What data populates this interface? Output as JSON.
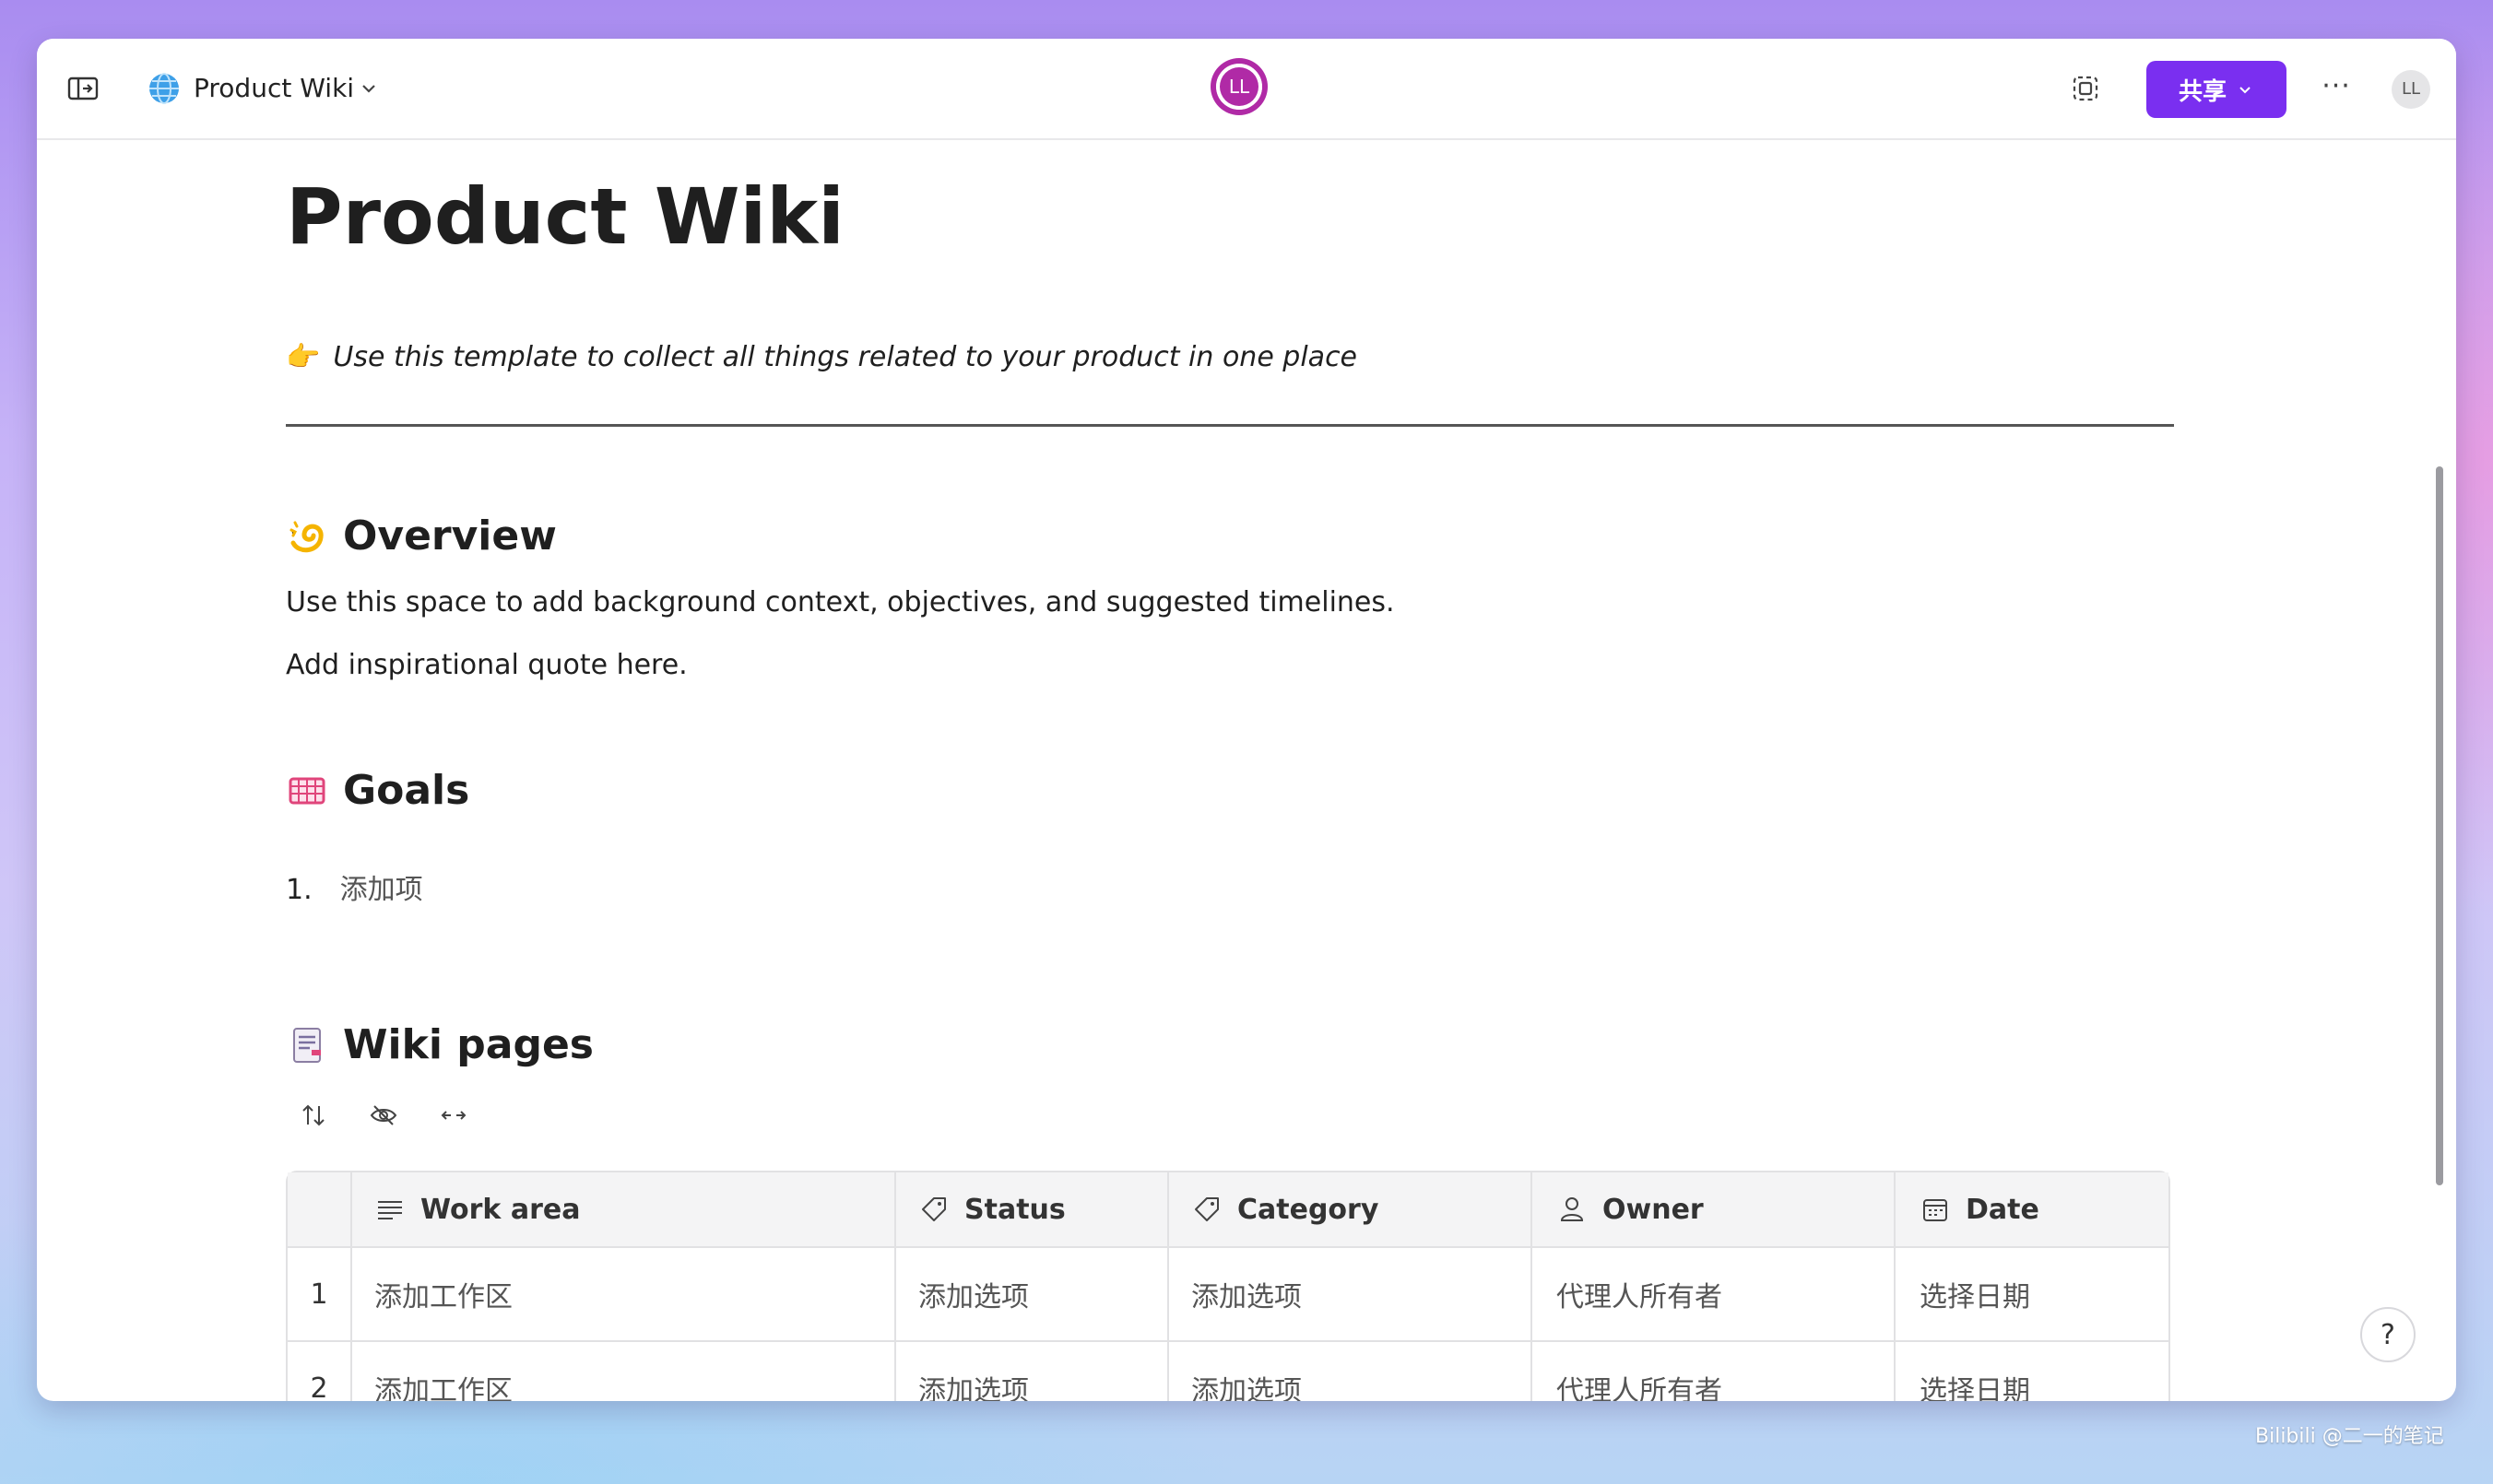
{
  "header": {
    "page_name": "Product Wiki",
    "collab_avatar": "LL",
    "share_label": "共享",
    "more_label": "···",
    "user_avatar": "LL"
  },
  "page": {
    "title": "Product Wiki",
    "callout_emoji": "👉",
    "callout_text": "Use this template to collect all things related to your product in one place",
    "overview": {
      "heading": "Overview",
      "icon": "dizzy-icon",
      "para1": "Use this space to add background context, objectives, and suggested timelines.",
      "para2": "Add inspirational quote here."
    },
    "goals": {
      "heading": "Goals",
      "icon": "goal-net-icon",
      "item_number": "1.",
      "item_text": "添加项"
    },
    "wiki": {
      "heading": "Wiki pages",
      "icon": "page-icon"
    }
  },
  "table": {
    "columns": [
      {
        "label": "Work area",
        "icon": "text-lines-icon"
      },
      {
        "label": "Status",
        "icon": "tag-icon"
      },
      {
        "label": "Category",
        "icon": "tag-icon"
      },
      {
        "label": "Owner",
        "icon": "person-icon"
      },
      {
        "label": "Date",
        "icon": "calendar-icon"
      }
    ],
    "rows": [
      {
        "num": "1",
        "work_area": "添加工作区",
        "status": "添加选项",
        "category": "添加选项",
        "owner": "代理人所有者",
        "date": "选择日期"
      },
      {
        "num": "2",
        "work_area": "添加工作区",
        "status": "添加选项",
        "category": "添加选项",
        "owner": "代理人所有者",
        "date": "选择日期"
      }
    ]
  },
  "help_label": "?",
  "watermark": "Bilibili @二一的笔记",
  "colors": {
    "accent": "#7a2ff0",
    "avatar": "#b02aa6"
  }
}
